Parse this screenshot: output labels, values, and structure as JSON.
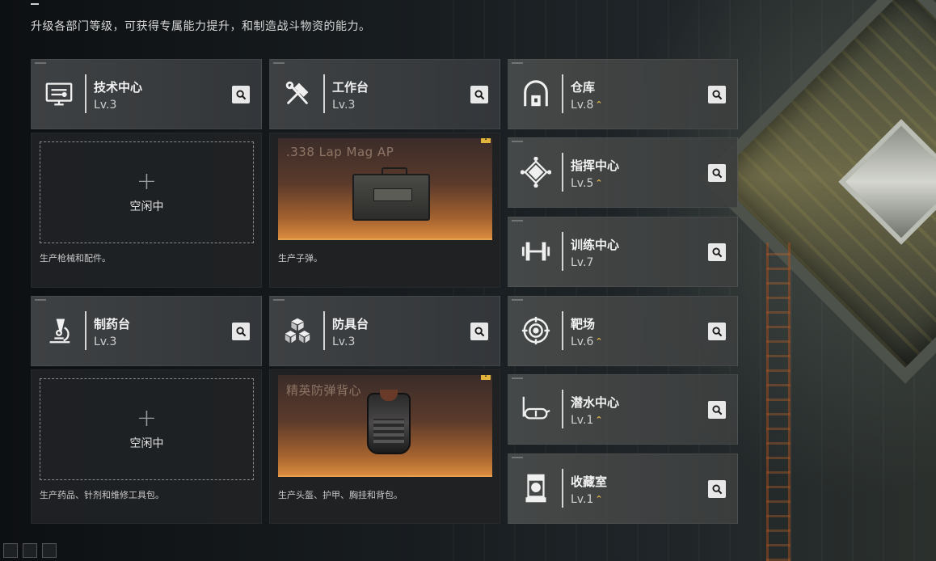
{
  "subtitle": "升级各部门等级，可获得专属能力提升，和制造战斗物资的能力。",
  "upgrade_glyph": "⌃",
  "departments": {
    "tech": {
      "name": "技术中心",
      "level": "Lv.3",
      "icon": "computer-icon",
      "status": "空闲中",
      "plus": "+",
      "desc": "生产枪械和配件。"
    },
    "workbench": {
      "name": "工作台",
      "level": "Lv.3",
      "icon": "tools-icon",
      "product": ".338 Lap Mag AP",
      "alert": "!",
      "desc": "生产子弹。"
    },
    "pharmacy": {
      "name": "制药台",
      "level": "Lv.3",
      "icon": "microscope-icon",
      "status": "空闲中",
      "plus": "+",
      "desc": "生产药品、针剂和维修工具包。"
    },
    "armor": {
      "name": "防具台",
      "level": "Lv.3",
      "icon": "blocks-icon",
      "product": "精英防弹背心",
      "alert": "!",
      "desc": "生产头盔、护甲、胸挂和背包。"
    },
    "warehouse": {
      "name": "仓库",
      "level": "Lv.8",
      "icon": "warehouse-icon",
      "upgradable": true
    },
    "command": {
      "name": "指挥中心",
      "level": "Lv.5",
      "icon": "command-icon",
      "upgradable": true
    },
    "training": {
      "name": "训练中心",
      "level": "Lv.7",
      "icon": "dumbbell-icon",
      "upgradable": false
    },
    "range": {
      "name": "靶场",
      "level": "Lv.6",
      "icon": "target-icon",
      "upgradable": true
    },
    "diving": {
      "name": "潜水中心",
      "level": "Lv.1",
      "icon": "diving-mask-icon",
      "upgradable": true
    },
    "collection": {
      "name": "收藏室",
      "level": "Lv.1",
      "icon": "display-case-icon",
      "upgradable": true
    }
  },
  "colors": {
    "accent": "#e1b24a",
    "product_glow": "#d98b3e"
  }
}
